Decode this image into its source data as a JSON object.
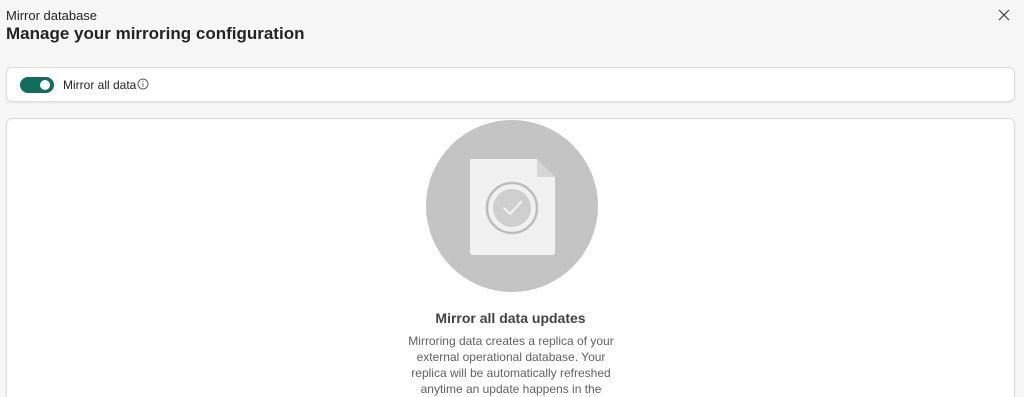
{
  "header": {
    "subtitle": "Mirror database",
    "title": "Manage your mirroring configuration",
    "close_icon": "close-icon"
  },
  "toggle": {
    "label": "Mirror all data",
    "state": "on",
    "accent_color": "#0f6e5c",
    "info_icon": "info-icon"
  },
  "empty_state": {
    "illustration_icon": "document-checkmark-icon",
    "heading": "Mirror all data updates",
    "description": "Mirroring data creates a replica of your external operational database. Your replica will be automatically refreshed anytime an update happens in the operational"
  }
}
